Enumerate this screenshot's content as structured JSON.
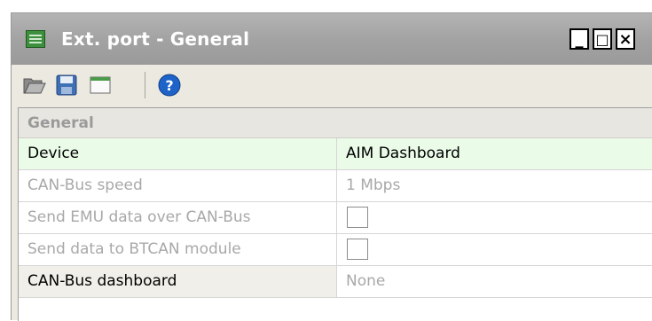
{
  "window": {
    "title": "Ext. port - General",
    "controls": {
      "minimize": "_",
      "maximize": "□",
      "close": "×"
    }
  },
  "toolbar": {
    "buttons": [
      {
        "name": "open-folder-icon"
      },
      {
        "name": "save-icon"
      },
      {
        "name": "window-icon"
      },
      {
        "name": "help-icon",
        "glyph": "?"
      }
    ]
  },
  "grid": {
    "section_title": "General",
    "rows": [
      {
        "label": "Device",
        "value": "AIM Dashboard"
      },
      {
        "label": "CAN-Bus speed",
        "value": "1 Mbps"
      },
      {
        "label": "Send EMU data over CAN-Bus",
        "checked": false
      },
      {
        "label": "Send data to BTCAN module",
        "checked": false
      },
      {
        "label": "CAN-Bus dashboard",
        "value": "None"
      }
    ]
  },
  "colors": {
    "titlebar": "#a3a3a3",
    "active_row": "#eafbe8",
    "help_blue": "#1e63c8"
  }
}
